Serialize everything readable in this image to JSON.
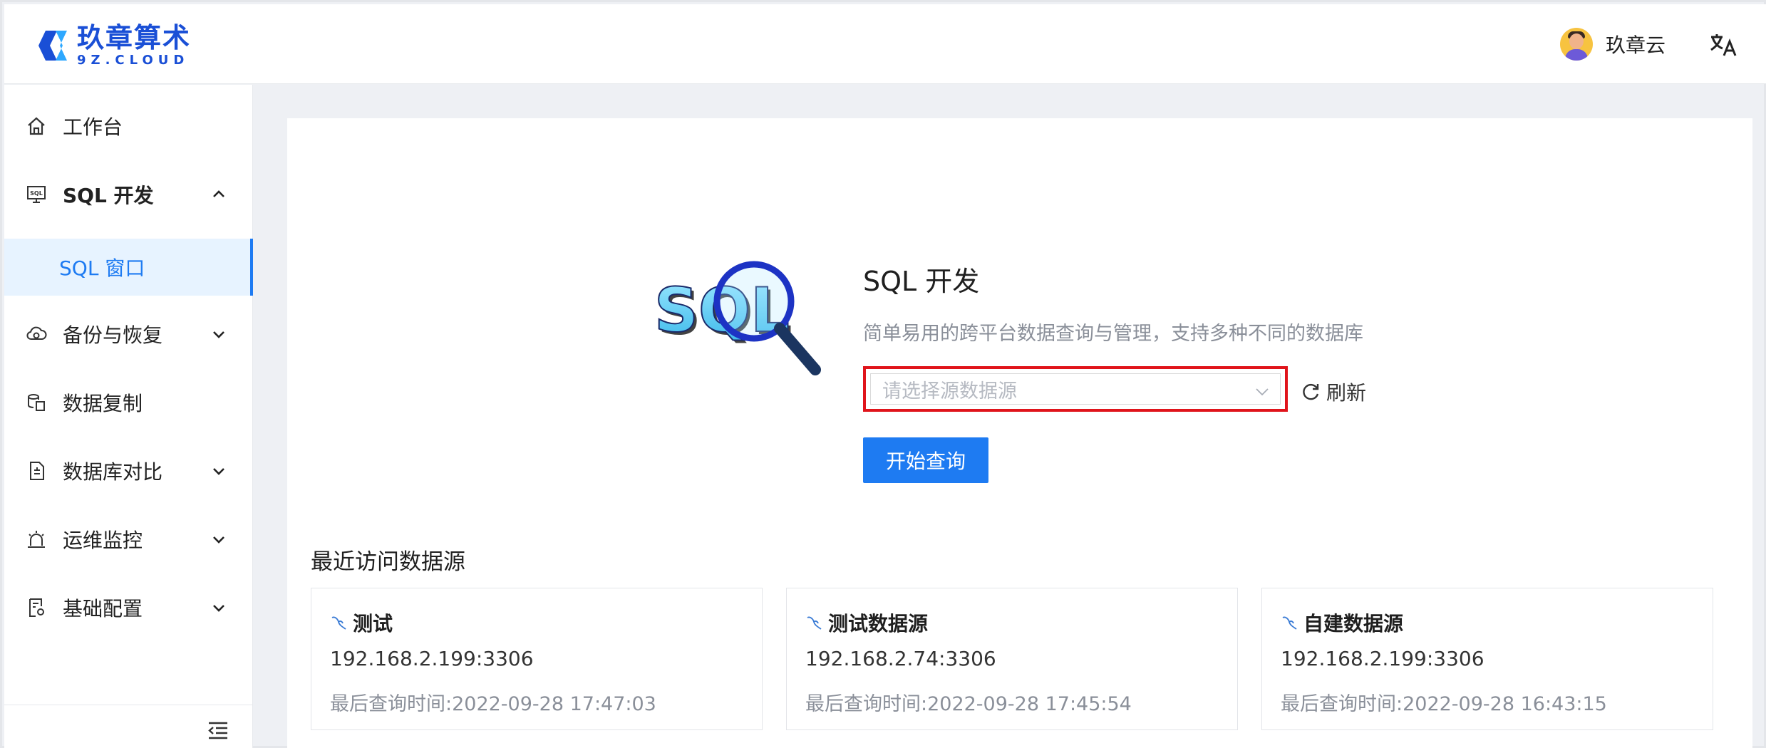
{
  "header": {
    "logo_cn": "玖章算术",
    "logo_en": "9Z.CLOUD",
    "user_name": "玖章云"
  },
  "sidebar": {
    "items": [
      {
        "label": "工作台",
        "icon": "home-icon"
      },
      {
        "label": "SQL 开发",
        "icon": "sql-monitor-icon",
        "expanded": true
      },
      {
        "label": "SQL 窗口",
        "active": true
      },
      {
        "label": "备份与恢复",
        "icon": "cloud-backup-icon"
      },
      {
        "label": "数据复制",
        "icon": "data-copy-icon"
      },
      {
        "label": "数据库对比",
        "icon": "db-compare-icon"
      },
      {
        "label": "运维监控",
        "icon": "alarm-icon"
      },
      {
        "label": "基础配置",
        "icon": "config-icon"
      }
    ]
  },
  "hero": {
    "logo_text": "SQL",
    "title": "SQL 开发",
    "description": "简单易用的跨平台数据查询与管理，支持多种不同的数据库",
    "select_placeholder": "请选择源数据源",
    "refresh_label": "刷新",
    "start_button": "开始查询"
  },
  "recent": {
    "title": "最近访问数据源",
    "cards": [
      {
        "name": "测试",
        "host": "192.168.2.199:3306",
        "last_query": "最后查询时间:2022-09-28 17:47:03"
      },
      {
        "name": "测试数据源",
        "host": "192.168.2.74:3306",
        "last_query": "最后查询时间:2022-09-28 17:45:54"
      },
      {
        "name": "自建数据源",
        "host": "192.168.2.199:3306",
        "last_query": "最后查询时间:2022-09-28 16:43:15"
      }
    ]
  },
  "colors": {
    "accent": "#1e7bf2",
    "highlight_border": "#e0141b",
    "active_bg": "#e7f3ff",
    "brand": "#1a4fd6"
  }
}
